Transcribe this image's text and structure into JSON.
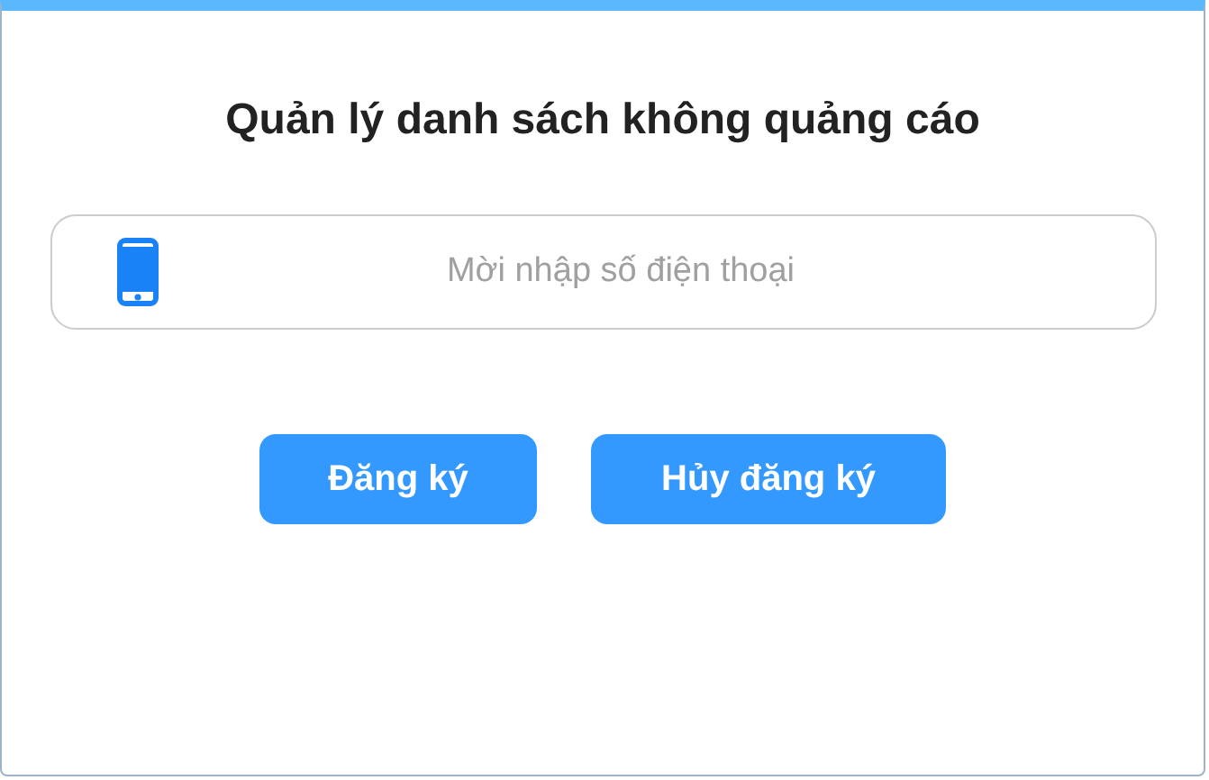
{
  "title": "Quản lý danh sách không quảng cáo",
  "phone_field": {
    "placeholder": "Mời nhập số điện thoại"
  },
  "buttons": [
    {
      "label": "Đăng ký"
    },
    {
      "label": "Hủy đăng ký"
    }
  ]
}
